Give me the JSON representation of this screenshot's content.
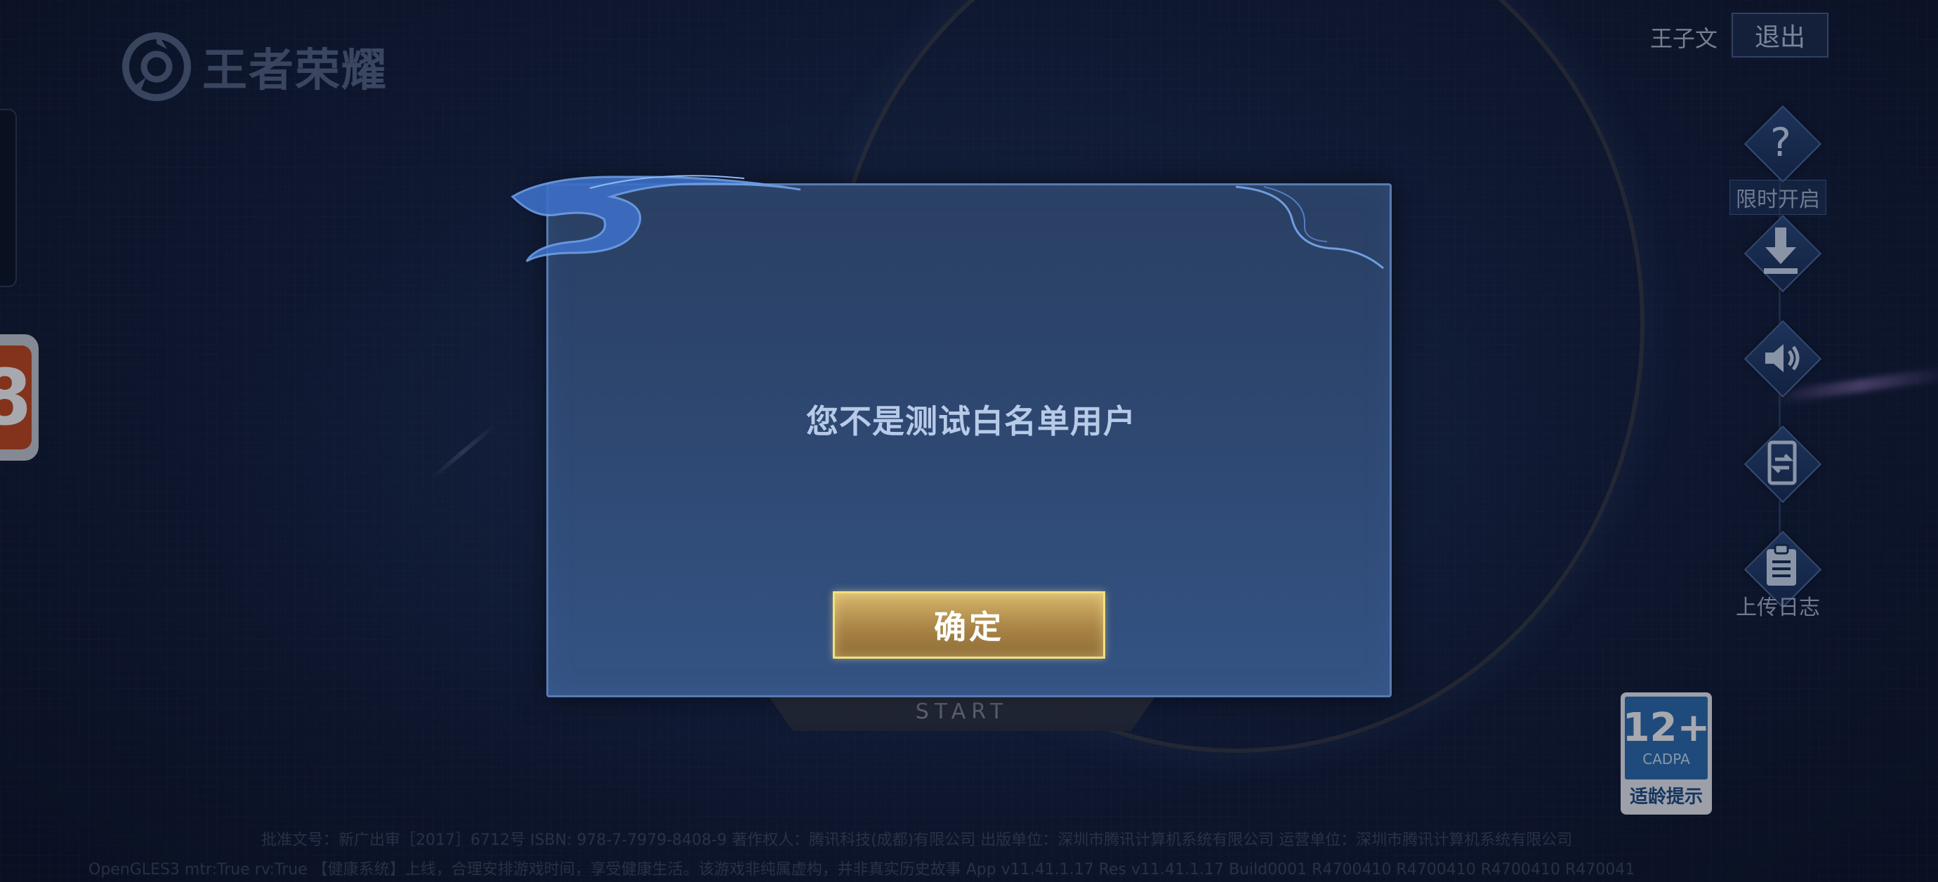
{
  "app": {
    "logo_text": "王者荣耀"
  },
  "header": {
    "user_name": "王子文",
    "logout_label": "退出"
  },
  "side_menu": {
    "items": [
      {
        "icon": "question-icon",
        "label": "限时开启"
      },
      {
        "icon": "download-icon",
        "label": ""
      },
      {
        "icon": "speaker-icon",
        "label": ""
      },
      {
        "icon": "switch-icon",
        "label": ""
      },
      {
        "icon": "clipboard-icon",
        "label": "上传日志"
      }
    ]
  },
  "start": {
    "label": "START"
  },
  "age_rating": {
    "age": "12+",
    "org": "CADPA",
    "tip": "适龄提示"
  },
  "footer": {
    "line1": "批准文号：新广出审［2017］6712号  ISBN: 978-7-7979-8408-9  著作权人：腾讯科技(成都)有限公司  出版单位：深圳市腾讯计算机系统有限公司  运营单位：深圳市腾讯计算机系统有限公司",
    "line2": "OpenGLES3 mtr:True rv:True  【健康系统】上线，合理安排游戏时间，享受健康生活。该游戏非纯属虚构，并非真实历史故事 App v11.41.1.17 Res v11.41.1.17 Build0001 R4700410 R4700410 R4700410 R4700410"
  },
  "dialog": {
    "message": "您不是测试白名单用户",
    "confirm_label": "确定"
  },
  "colors": {
    "dialog_bg": "#2f4a75",
    "dialog_border": "#5a7bb0",
    "message_text": "#b7cbe8",
    "confirm_gold": "#c9a65c",
    "confirm_border": "#f2e07c"
  }
}
